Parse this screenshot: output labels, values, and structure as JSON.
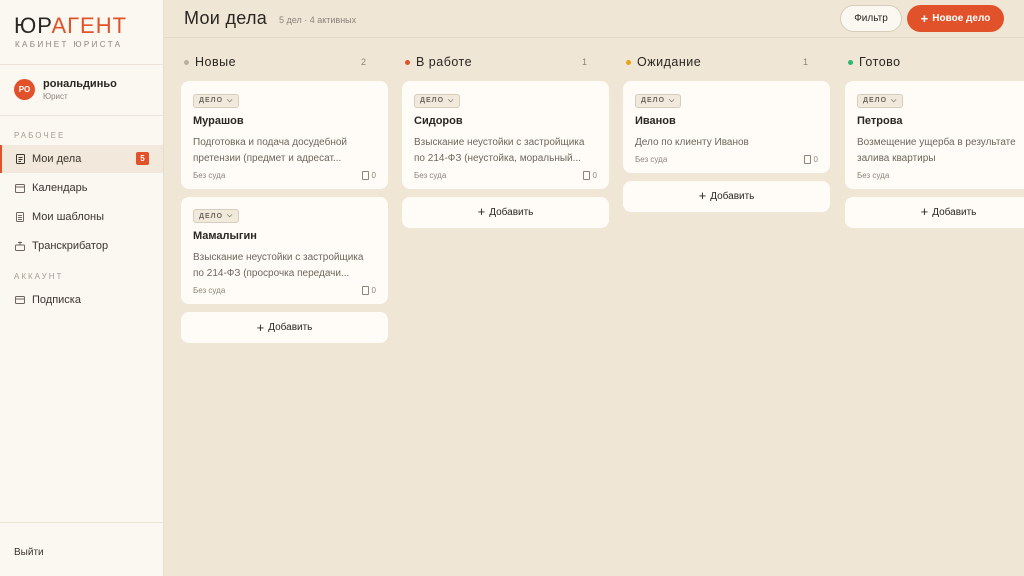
{
  "sidebar": {
    "logo_main": "ЮР",
    "logo_accent": "АГЕНТ",
    "logo_sub": "КАБИНЕТ ЮРИСТА",
    "user": {
      "initials": "РО",
      "name": "рональдиньо",
      "role": "Юрист"
    },
    "section_work": "РАБОЧЕЕ",
    "nav": [
      {
        "label": "Мои дела",
        "icon": "document-icon",
        "badge": "5",
        "active": true
      },
      {
        "label": "Календарь",
        "icon": "calendar-icon"
      },
      {
        "label": "Мои шаблоны",
        "icon": "template-icon"
      },
      {
        "label": "Транскрибатор",
        "icon": "transcriber-icon"
      }
    ],
    "section_account": "АККАУНТ",
    "account_nav": [
      {
        "label": "Подписка",
        "icon": "card-icon"
      }
    ],
    "logout": "Выйти"
  },
  "header": {
    "title": "Мои дела",
    "meta": "5 дел · 4 активных",
    "filter_label": "Фильтр",
    "new_label": "Новое дело",
    "accent": "#e2522a"
  },
  "board": {
    "add_label": "Добавить",
    "columns": [
      {
        "title": "Новые",
        "count": "2",
        "color": "#b8b0a4",
        "cards": [
          {
            "tag": "ДЕЛО",
            "title": "Мурашов",
            "desc": "Подготовка и подача досудебной претензии (предмет и адресат...",
            "court": "Без суда",
            "docs": "0"
          },
          {
            "tag": "ДЕЛО",
            "title": "Мамалыгин",
            "desc": "Взыскание неустойки с застройщика по 214-ФЗ (просрочка передачи...",
            "court": "Без суда",
            "docs": "0"
          }
        ]
      },
      {
        "title": "В работе",
        "count": "1",
        "color": "#e2522a",
        "cards": [
          {
            "tag": "ДЕЛО",
            "title": "Сидоров",
            "desc": "Взыскание неустойки с застройщика по 214-ФЗ (неустойка, моральный...",
            "court": "Без суда",
            "docs": "0"
          }
        ]
      },
      {
        "title": "Ожидание",
        "count": "1",
        "color": "#e8a317",
        "cards": [
          {
            "tag": "ДЕЛО",
            "title": "Иванов",
            "desc": "Дело по клиенту Иванов",
            "court": "Без суда",
            "docs": "0"
          }
        ]
      },
      {
        "title": "Готово",
        "count": "",
        "color": "#2fb86a",
        "cards": [
          {
            "tag": "ДЕЛО",
            "title": "Петрова",
            "desc": "Возмещение ущерба в результате залива квартиры",
            "court": "Без суда",
            "docs": ""
          }
        ]
      }
    ]
  }
}
